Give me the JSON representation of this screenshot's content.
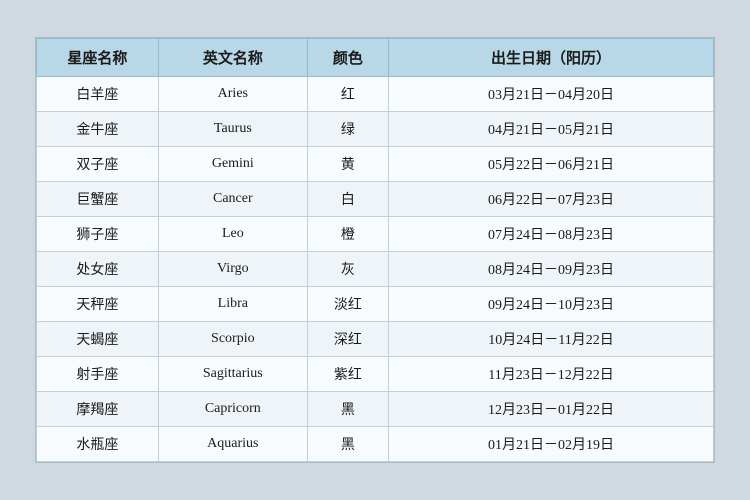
{
  "table": {
    "headers": {
      "col1": "星座名称",
      "col2": "英文名称",
      "col3": "颜色",
      "col4": "出生日期（阳历）"
    },
    "rows": [
      {
        "chinese": "白羊座",
        "english": "Aries",
        "color": "红",
        "date": "03月21日－04月20日"
      },
      {
        "chinese": "金牛座",
        "english": "Taurus",
        "color": "绿",
        "date": "04月21日－05月21日"
      },
      {
        "chinese": "双子座",
        "english": "Gemini",
        "color": "黄",
        "date": "05月22日－06月21日"
      },
      {
        "chinese": "巨蟹座",
        "english": "Cancer",
        "color": "白",
        "date": "06月22日－07月23日"
      },
      {
        "chinese": "狮子座",
        "english": "Leo",
        "color": "橙",
        "date": "07月24日－08月23日"
      },
      {
        "chinese": "处女座",
        "english": "Virgo",
        "color": "灰",
        "date": "08月24日－09月23日"
      },
      {
        "chinese": "天秤座",
        "english": "Libra",
        "color": "淡红",
        "date": "09月24日－10月23日"
      },
      {
        "chinese": "天蝎座",
        "english": "Scorpio",
        "color": "深红",
        "date": "10月24日－11月22日"
      },
      {
        "chinese": "射手座",
        "english": "Sagittarius",
        "color": "紫红",
        "date": "11月23日－12月22日"
      },
      {
        "chinese": "摩羯座",
        "english": "Capricorn",
        "color": "黑",
        "date": "12月23日－01月22日"
      },
      {
        "chinese": "水瓶座",
        "english": "Aquarius",
        "color": "黑",
        "date": "01月21日－02月19日"
      }
    ]
  }
}
